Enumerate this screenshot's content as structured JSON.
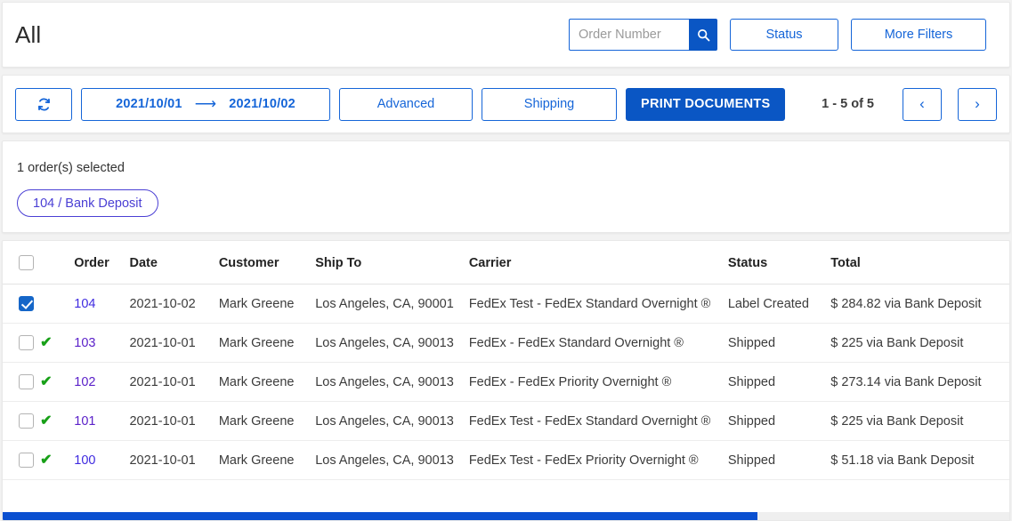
{
  "header": {
    "title": "All",
    "search": {
      "placeholder": "Order Number",
      "value": "",
      "icon": "search-icon"
    },
    "status_button": "Status",
    "more_filters_button": "More Filters"
  },
  "toolbar": {
    "refresh_icon": "refresh-icon",
    "date_from": "2021/10/01",
    "date_arrow": "⟶",
    "date_to": "2021/10/02",
    "advanced_button": "Advanced",
    "shipping_button": "Shipping",
    "print_documents_button": "PRINT DOCUMENTS",
    "pagination_label": "1 - 5 of 5",
    "prev_icon": "‹",
    "next_icon": "›"
  },
  "selection": {
    "count_label": "1 order(s) selected",
    "chips": [
      {
        "label": "104 / Bank Deposit"
      }
    ]
  },
  "table": {
    "columns": [
      "Order",
      "Date",
      "Customer",
      "Ship To",
      "Carrier",
      "Status",
      "Total"
    ],
    "rows": [
      {
        "checked": true,
        "flag": "",
        "order": "104",
        "date": "2021-10-02",
        "customer": "Mark Greene",
        "ship_to": "Los Angeles, CA, 90001",
        "carrier": "FedEx Test - FedEx Standard Overnight ®",
        "status": "Label Created",
        "total": "$ 284.82 via Bank Deposit"
      },
      {
        "checked": false,
        "flag": "✔",
        "order": "103",
        "date": "2021-10-01",
        "customer": "Mark Greene",
        "ship_to": "Los Angeles, CA, 90013",
        "carrier": "FedEx - FedEx Standard Overnight ®",
        "status": "Shipped",
        "total": "$ 225 via Bank Deposit"
      },
      {
        "checked": false,
        "flag": "✔",
        "order": "102",
        "date": "2021-10-01",
        "customer": "Mark Greene",
        "ship_to": "Los Angeles, CA, 90013",
        "carrier": "FedEx - FedEx Priority Overnight ®",
        "status": "Shipped",
        "total": "$ 273.14 via Bank Deposit"
      },
      {
        "checked": false,
        "flag": "✔",
        "order": "101",
        "date": "2021-10-01",
        "customer": "Mark Greene",
        "ship_to": "Los Angeles, CA, 90013",
        "carrier": "FedEx Test - FedEx Standard Overnight ®",
        "status": "Shipped",
        "total": "$ 225 via Bank Deposit"
      },
      {
        "checked": false,
        "flag": "✔",
        "order": "100",
        "date": "2021-10-01",
        "customer": "Mark Greene",
        "ship_to": "Los Angeles, CA, 90013",
        "carrier": "FedEx Test - FedEx Priority Overnight ®",
        "status": "Shipped",
        "total": "$ 51.18 via Bank Deposit"
      }
    ]
  },
  "colors": {
    "primary_blue": "#0a56c4",
    "outline_blue": "#1565d8",
    "chip_purple": "#4a3fd4",
    "link_purple": "#5b21c9",
    "green_check": "#18a018",
    "page_bg": "#f2f2f2"
  },
  "scrollbar": {
    "thumb_percent": 75
  }
}
